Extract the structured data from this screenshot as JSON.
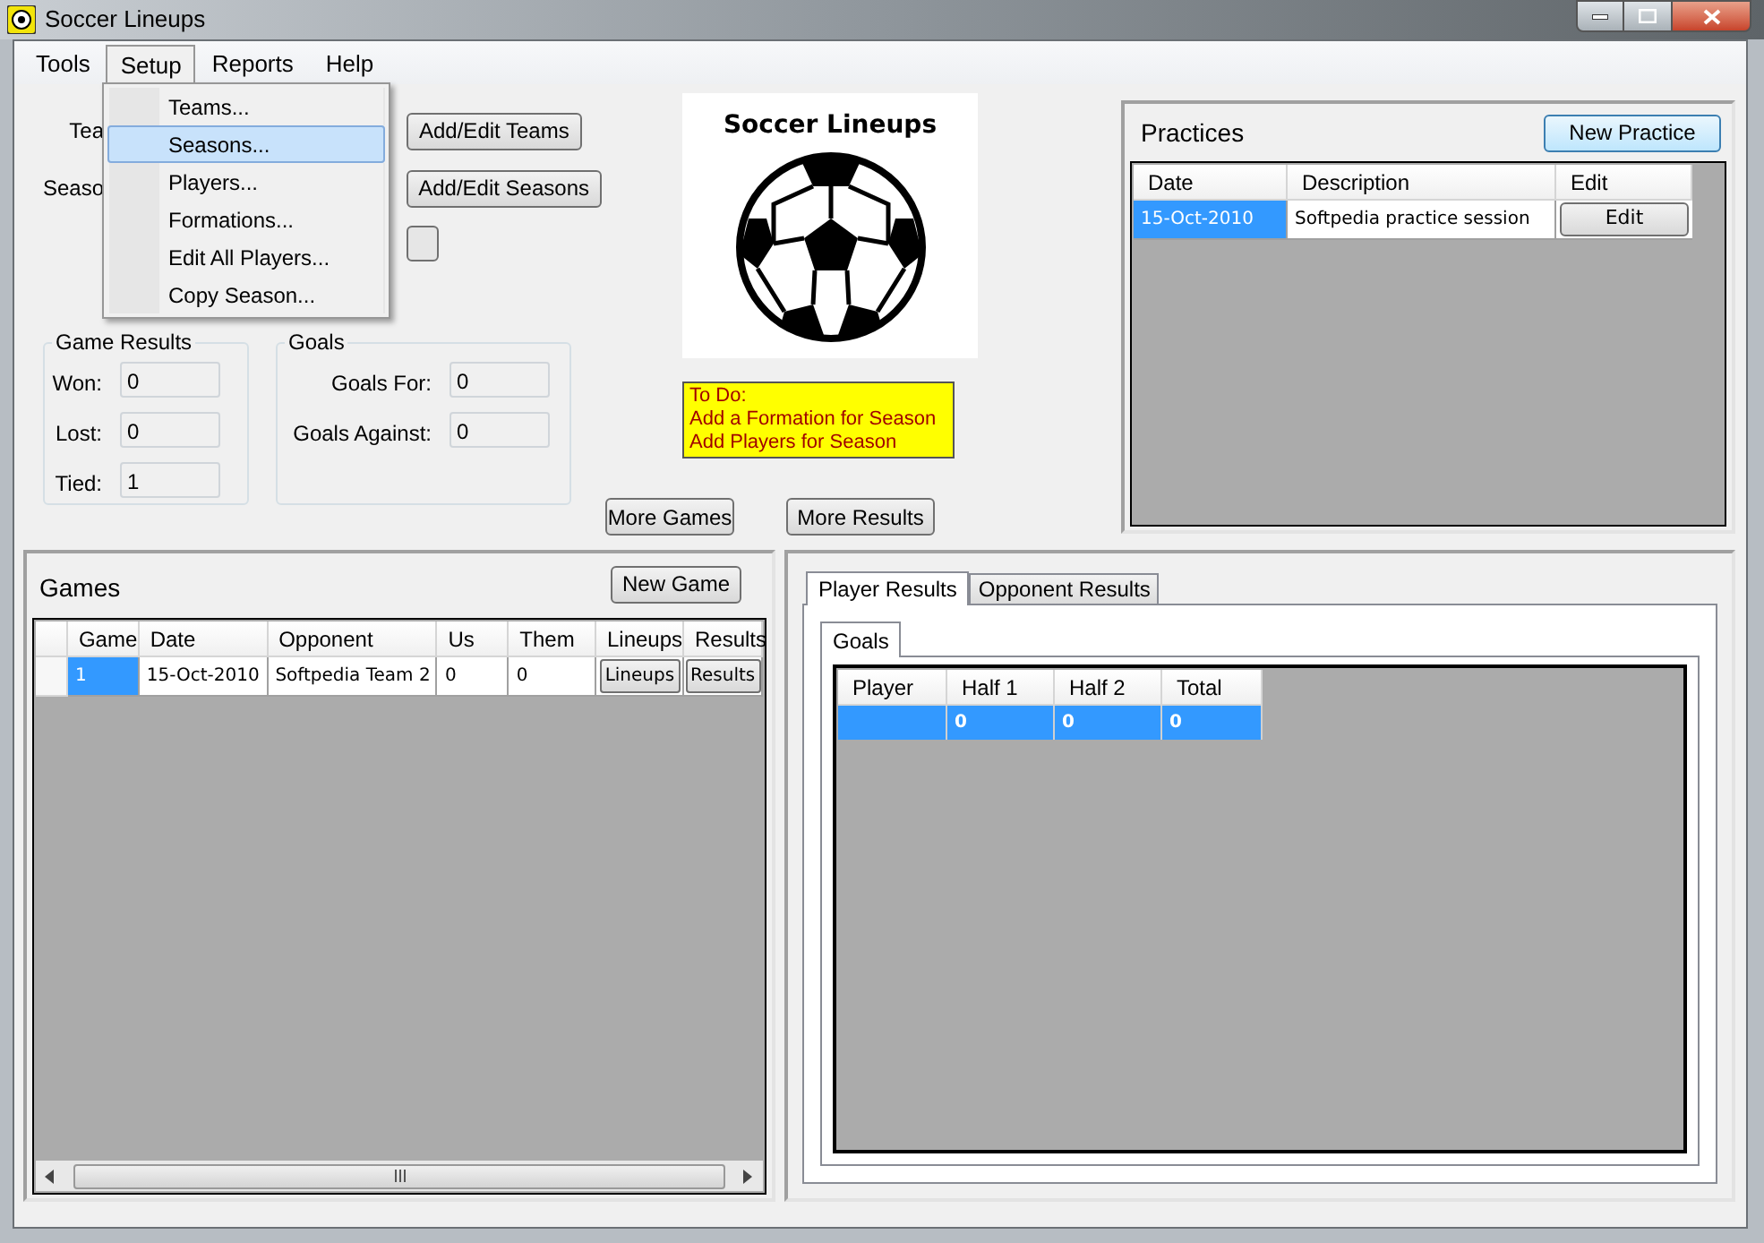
{
  "window": {
    "title": "Soccer Lineups"
  },
  "menu": [
    {
      "label": "Tools",
      "selected": false
    },
    {
      "label": "Setup",
      "selected": true
    },
    {
      "label": "Reports",
      "selected": false
    },
    {
      "label": "Help",
      "selected": false
    }
  ],
  "dropdown": [
    {
      "label": "Teams...",
      "selected": false
    },
    {
      "label": "Seasons...",
      "selected": true
    },
    {
      "label": "Players...",
      "selected": false
    },
    {
      "label": "Formations...",
      "selected": false
    },
    {
      "label": "Edit All Players...",
      "selected": false
    },
    {
      "label": "Copy Season...",
      "selected": false
    }
  ],
  "selectors": [
    {
      "label": "Tea",
      "button": "Add/Edit Teams"
    },
    {
      "label": "Seaso",
      "button": "Add/Edit Seasons"
    }
  ],
  "game_results": {
    "title": "Game Results",
    "fields": [
      {
        "label": "Won:",
        "value": "0"
      },
      {
        "label": "Lost:",
        "value": "0"
      },
      {
        "label": "Tied:",
        "value": "1"
      }
    ]
  },
  "goals": {
    "title": "Goals",
    "fields": [
      {
        "label": "Goals For:",
        "value": "0"
      },
      {
        "label": "Goals Against:",
        "value": "0"
      }
    ]
  },
  "logo": {
    "title": "Soccer Lineups"
  },
  "todo": {
    "title": "To Do:",
    "items": [
      "Add a Formation for Season",
      "Add Players for Season"
    ]
  },
  "more_games": "More Games",
  "more_results": "More Results",
  "practices": {
    "title": "Practices",
    "button": "New Practice",
    "columns": [
      "Date",
      "Description",
      "Edit"
    ],
    "rows": [
      {
        "cells": [
          "15-Oct-2010",
          "Softpedia practice session"
        ],
        "button": "Edit",
        "selected": true
      }
    ]
  },
  "games": {
    "title": "Games",
    "button": "New Game",
    "columns": [
      "Game",
      "Date",
      "Opponent",
      "Us",
      "Them",
      "Lineups",
      "Results"
    ],
    "rows": [
      {
        "cells": [
          "1",
          "15-Oct-2010",
          "Softpedia Team 2",
          "0",
          "0"
        ],
        "buttons": [
          "Lineups",
          "Results"
        ],
        "selected": true
      }
    ]
  },
  "results": {
    "tabs": [
      {
        "label": "Player Results",
        "selected": true
      },
      {
        "label": "Opponent Results",
        "selected": false
      }
    ],
    "subtabs": [
      {
        "label": "Goals",
        "selected": true
      }
    ],
    "columns": [
      "Player",
      "Half 1",
      "Half 2",
      "Total"
    ],
    "rows": [
      {
        "values": [
          "0",
          "0",
          "0"
        ],
        "selected": true
      }
    ]
  }
}
